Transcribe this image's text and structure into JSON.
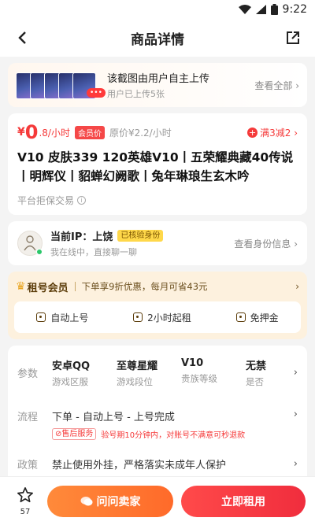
{
  "status_bar": {
    "time": "9:22"
  },
  "header": {
    "title": "商品详情"
  },
  "screenshots": {
    "badge": "•••",
    "title": "该截图由用户自主上传",
    "subtitle": "用户已上传5张",
    "view_all": "查看全部 ›"
  },
  "price": {
    "currency": "¥",
    "integer": "0",
    "unit": ".8/小时",
    "member_tag": "会员价",
    "original": "原价¥2.2/小时",
    "promo": "满3减2 ›"
  },
  "goods": {
    "title": "V10 皮肤339 120英雄V10丨五荣耀典藏40传说丨明辉仪丨貂蝉幻阙歌丨兔年琳琅生玄木吟",
    "guarantee": "平台拒保交易"
  },
  "seller": {
    "ip": "当前IP：上饶",
    "verified": "已核验身份",
    "status": "我在线中，直接聊一聊",
    "link": "查看身份信息 ›"
  },
  "membership": {
    "title": "租号会员",
    "desc": "下单享9折优惠，每月可省43元",
    "perks": [
      "自动上号",
      "2小时起租",
      "免押金"
    ]
  },
  "params": {
    "label": "参数",
    "specs": [
      {
        "value": "安卓QQ",
        "key": "游戏区服"
      },
      {
        "value": "至尊星耀",
        "key": "游戏段位"
      },
      {
        "value": "V10",
        "key": "贵族等级"
      },
      {
        "value": "无禁",
        "key": "是否"
      }
    ]
  },
  "flow": {
    "label": "流程",
    "text": "下单 - 自动上号 - 上号完成",
    "after_sale": "⊘售后服务",
    "note": "验号期10分钟内，对账号不满意可秒退款"
  },
  "policy": {
    "label": "政策",
    "text": "禁止使用外挂，严格落实未成年人保护"
  },
  "bottom": {
    "fav_count": "57",
    "chat_label": "问问卖家",
    "rent_label": "立即租用"
  },
  "colors": {
    "accent_red": "#f53a3a",
    "accent_orange": "#ff7a30",
    "member_bg": "#fdf1de"
  }
}
